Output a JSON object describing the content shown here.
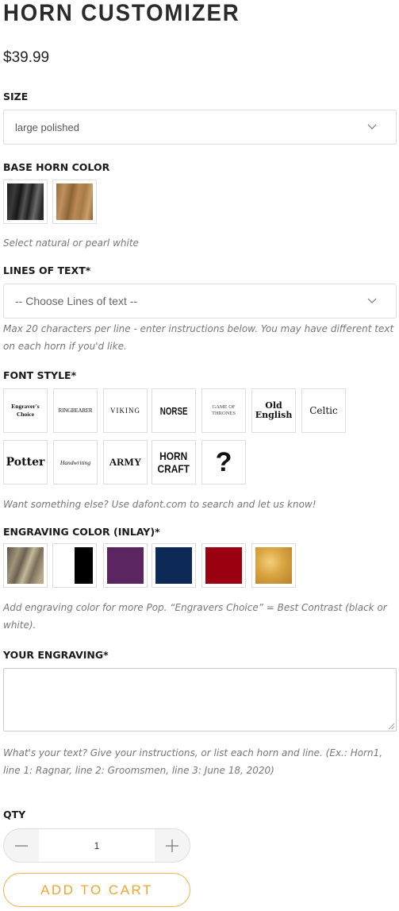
{
  "title": "HORN CUSTOMIZER",
  "price": "$39.99",
  "size": {
    "label": "SIZE",
    "value": "large polished"
  },
  "base_color": {
    "label": "BASE HORN COLOR",
    "swatches": [
      {
        "name": "natural"
      },
      {
        "name": "pearl white"
      }
    ],
    "note": "Select natural or pearl white"
  },
  "lines": {
    "label": "LINES OF TEXT*",
    "placeholder": "-- Choose Lines of text --",
    "note": "Max 20 characters per line - enter instructions below. You may have different text on each horn if you'd like."
  },
  "font_style": {
    "label": "FONT STYLE*",
    "fonts": [
      {
        "text": "Engraver's Choice"
      },
      {
        "text": "RINGBEARER"
      },
      {
        "text": "VIKING"
      },
      {
        "text": "NORSE"
      },
      {
        "text": "GAME OF THRONES"
      },
      {
        "text": "Old English"
      },
      {
        "text": "Celtic"
      },
      {
        "text": "Potter"
      },
      {
        "text": "Handwriting"
      },
      {
        "text": "ARMY"
      },
      {
        "text": "HORN CRAFT"
      },
      {
        "text": "?"
      }
    ],
    "note": "Want something else? Use dafont.com to search and let us know!"
  },
  "engraving_color": {
    "label": "ENGRAVING COLOR (INLAY)*",
    "swatches": [
      {
        "name": "natural",
        "color": "#8a7a60"
      },
      {
        "name": "black/white",
        "color": "#000000"
      },
      {
        "name": "purple",
        "color": "#5a2560"
      },
      {
        "name": "navy",
        "color": "#0d2a57"
      },
      {
        "name": "red",
        "color": "#9a0010"
      },
      {
        "name": "gold",
        "color": "#d9a441"
      }
    ],
    "note": "Add engraving color for more Pop. “Engravers Choice” = Best Contrast (black or white)."
  },
  "engraving": {
    "label": "YOUR ENGRAVING*",
    "value": "",
    "note": "What's your text? Give your instructions, or list each horn and line. (Ex.: Horn1, line 1: Ragnar, line 2: Groomsmen, line 3: June 18, 2020)"
  },
  "qty": {
    "label": "QTY",
    "value": "1"
  },
  "add_to_cart": "ADD TO CART",
  "colors": {
    "accent": "#f0a42c"
  }
}
